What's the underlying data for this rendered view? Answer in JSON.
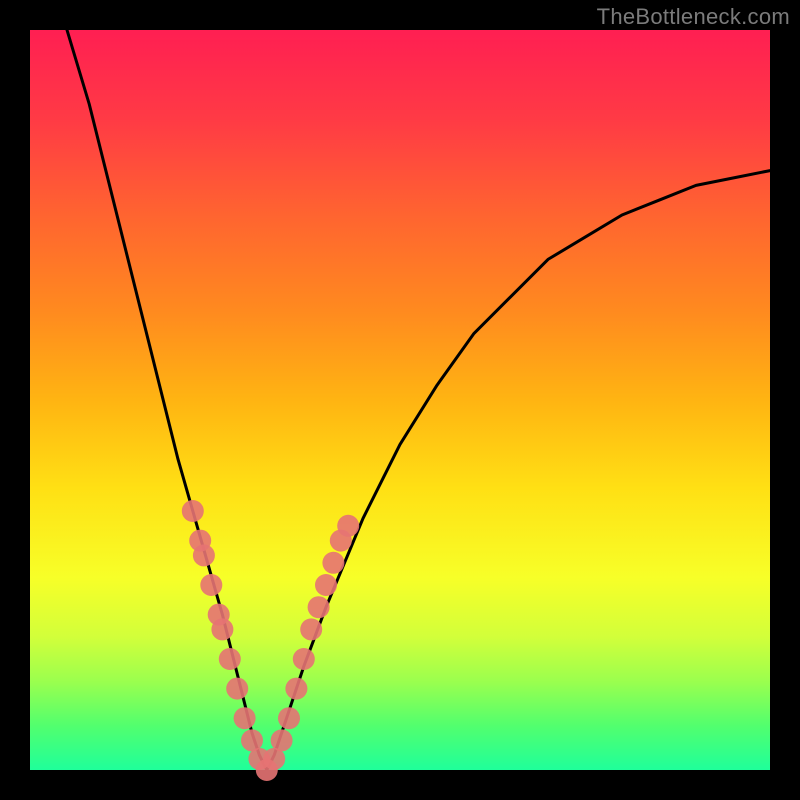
{
  "watermark": "TheBottleneck.com",
  "chart_data": {
    "type": "line",
    "title": "",
    "xlabel": "",
    "ylabel": "",
    "xlim": [
      0,
      100
    ],
    "ylim": [
      0,
      100
    ],
    "grid": false,
    "legend": false,
    "series": [
      {
        "name": "bottleneck-curve",
        "x": [
          5,
          8,
          10,
          12,
          14,
          16,
          18,
          20,
          22,
          24,
          26,
          27,
          28,
          29,
          30,
          31,
          32,
          33,
          34,
          35,
          37,
          40,
          45,
          50,
          55,
          60,
          65,
          70,
          75,
          80,
          85,
          90,
          95,
          100
        ],
        "y": [
          100,
          90,
          82,
          74,
          66,
          58,
          50,
          42,
          35,
          28,
          21,
          17,
          13,
          9,
          5,
          2,
          0,
          2,
          5,
          8,
          14,
          22,
          34,
          44,
          52,
          59,
          64,
          69,
          72,
          75,
          77,
          79,
          80,
          81
        ]
      },
      {
        "name": "highlight-dots",
        "type": "scatter",
        "points": [
          {
            "x": 22,
            "y": 35
          },
          {
            "x": 23,
            "y": 31
          },
          {
            "x": 23.5,
            "y": 29
          },
          {
            "x": 24.5,
            "y": 25
          },
          {
            "x": 25.5,
            "y": 21
          },
          {
            "x": 26,
            "y": 19
          },
          {
            "x": 27,
            "y": 15
          },
          {
            "x": 28,
            "y": 11
          },
          {
            "x": 29,
            "y": 7
          },
          {
            "x": 30,
            "y": 4
          },
          {
            "x": 31,
            "y": 1.5
          },
          {
            "x": 32,
            "y": 0
          },
          {
            "x": 33,
            "y": 1.5
          },
          {
            "x": 34,
            "y": 4
          },
          {
            "x": 35,
            "y": 7
          },
          {
            "x": 36,
            "y": 11
          },
          {
            "x": 37,
            "y": 15
          },
          {
            "x": 38,
            "y": 19
          },
          {
            "x": 39,
            "y": 22
          },
          {
            "x": 40,
            "y": 25
          },
          {
            "x": 41,
            "y": 28
          },
          {
            "x": 42,
            "y": 31
          },
          {
            "x": 43,
            "y": 33
          }
        ]
      }
    ]
  }
}
